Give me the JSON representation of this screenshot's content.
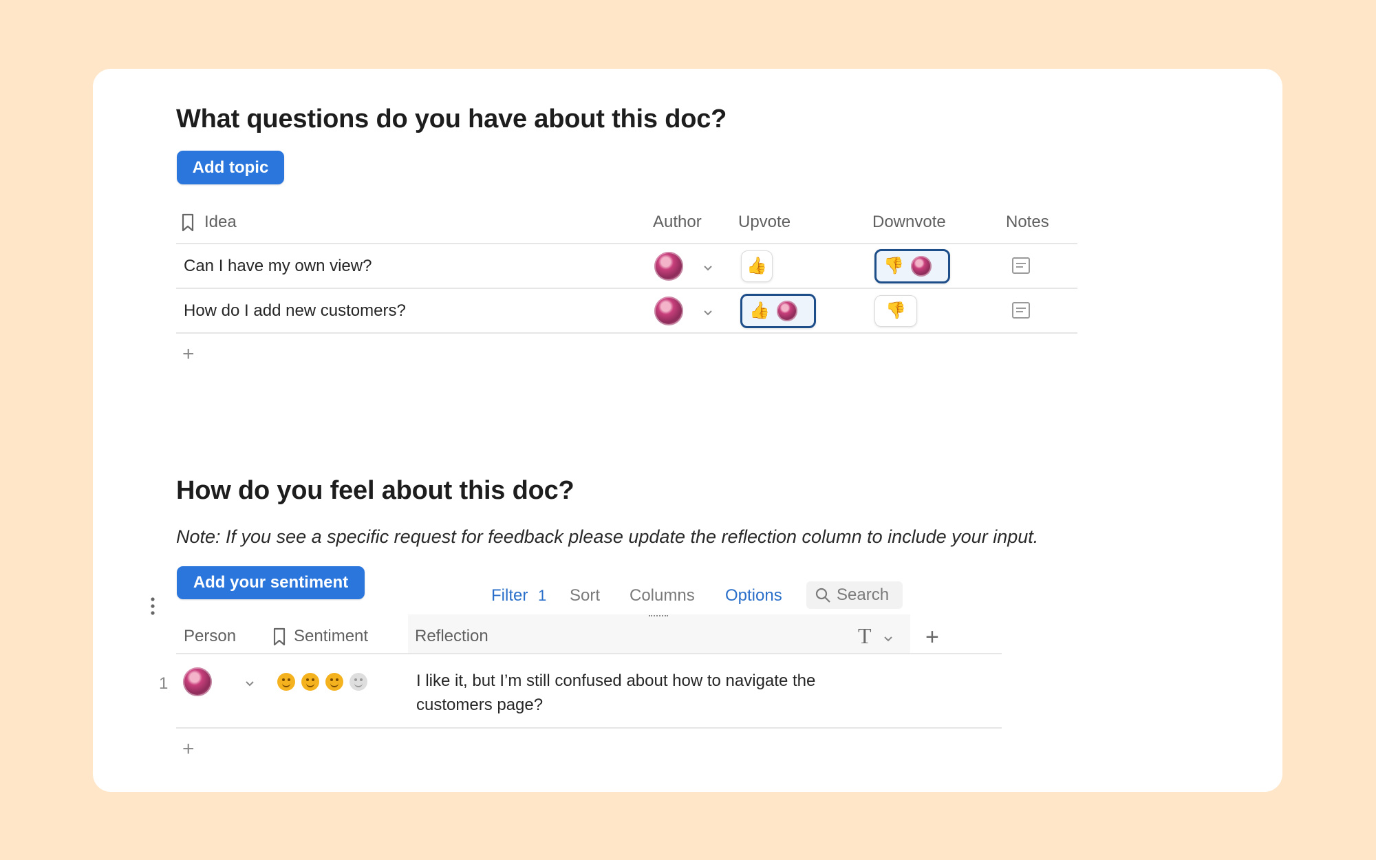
{
  "section1": {
    "title": "What questions do you have about this doc?",
    "add_button": "Add topic",
    "columns": {
      "idea": "Idea",
      "author": "Author",
      "upvote": "Upvote",
      "downvote": "Downvote",
      "notes": "Notes"
    },
    "rows": [
      {
        "idea": "Can I have my own view?",
        "upvote_active": false,
        "downvote_active": true
      },
      {
        "idea": "How do I add new customers?",
        "upvote_active": true,
        "downvote_active": false
      }
    ]
  },
  "section2": {
    "title": "How do you feel about this doc?",
    "note": "Note: If you see a specific request for feedback please update the reflection column to include your input.",
    "add_button": "Add your sentiment",
    "toolbar": {
      "filter": "Filter",
      "filter_count": "1",
      "sort": "Sort",
      "columns": "Columns",
      "options": "Options",
      "search": "Search"
    },
    "columns": {
      "person": "Person",
      "sentiment": "Sentiment",
      "reflection": "Reflection"
    },
    "rows": [
      {
        "index": "1",
        "sentiment_level": 3,
        "sentiment_max": 4,
        "reflection_line1": "I like it, but I’m still confused about how to navigate the",
        "reflection_line2": "customers page?"
      }
    ]
  },
  "colors": {
    "background": "#ffe6c8",
    "accent": "#2a76dd",
    "active_border": "#1d4e8a"
  },
  "icons": [
    "bookmark-icon",
    "chevron-down-icon",
    "thumbs-up-icon",
    "thumbs-down-icon",
    "notes-icon",
    "plus-icon",
    "more-vertical-icon",
    "search-icon",
    "text-type-icon",
    "emoji-icon"
  ]
}
